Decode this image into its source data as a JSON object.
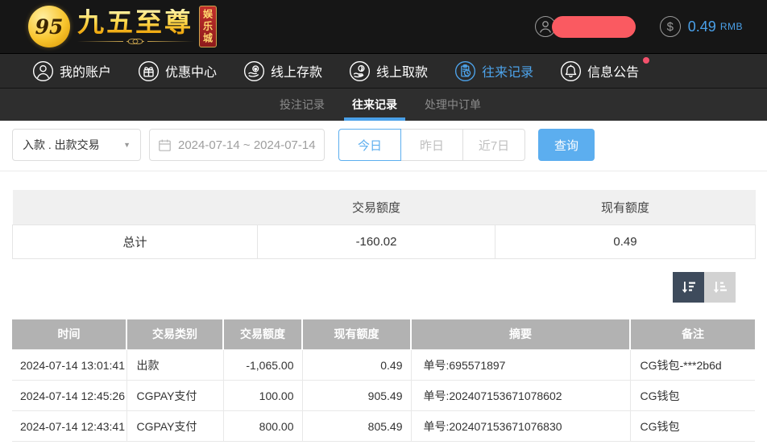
{
  "colors": {
    "accent_blue": "#4da3ea",
    "button_blue": "#5caeef",
    "tab_underline_blue": "#4aa0e8",
    "alert_dot_red": "#f4516c",
    "redacted_pill_red": "#fa5a61",
    "logo_gold": "#ffd94e",
    "logo_box_red": "#a6201f",
    "records_header_gray": "#b2b2b2",
    "top_header_bg": "#161616",
    "nav_bg": "#2a2a2a",
    "subtab_bg": "#2e2e2e"
  },
  "header": {
    "logo": {
      "monogram": "95",
      "title": "九五至尊",
      "subtitle": "娱乐城"
    },
    "user": {
      "avatar_icon": "user-avatar-icon",
      "dollar_icon_glyph": "$",
      "balance": "0.49",
      "currency": "RMB"
    }
  },
  "nav": {
    "items": [
      {
        "label": "我的账户",
        "icon": "account-icon",
        "active": false
      },
      {
        "label": "优惠中心",
        "icon": "promotions-gift-icon",
        "active": false
      },
      {
        "label": "线上存款",
        "icon": "deposit-icon",
        "active": false
      },
      {
        "label": "线上取款",
        "icon": "withdraw-icon",
        "active": false
      },
      {
        "label": "往来记录",
        "icon": "transfer-records-icon",
        "active": true
      },
      {
        "label": "信息公告",
        "icon": "announcements-bell-icon",
        "active": false,
        "has_unread_dot": true
      }
    ]
  },
  "subtabs": {
    "items": [
      {
        "label": "投注记录",
        "active": false
      },
      {
        "label": "往来记录",
        "active": true
      },
      {
        "label": "处理中订单",
        "active": false
      }
    ]
  },
  "filters": {
    "type_select": {
      "value": "入款 . 出款交易",
      "caret_glyph": "▼",
      "icon": "caret-down-icon"
    },
    "date_range": {
      "value": "2024-07-14 ~ 2024-07-14",
      "icon": "calendar-icon"
    },
    "quick_ranges": [
      {
        "label": "今日",
        "active": true
      },
      {
        "label": "昨日",
        "active": false
      },
      {
        "label": "近7日",
        "active": false
      }
    ],
    "search_button": "查询"
  },
  "summary_table": {
    "headers": {
      "corner": "",
      "amount": "交易额度",
      "balance": "现有额度"
    },
    "total_row": {
      "label": "总计",
      "amount": "-160.02",
      "balance": "0.49"
    }
  },
  "sort": {
    "desc_icon": "sort-descending-icon",
    "asc_icon": "sort-ascending-icon"
  },
  "records_table": {
    "headers": [
      "时间",
      "交易类别",
      "交易额度",
      "现有额度",
      "摘要",
      "备注"
    ],
    "rows": [
      {
        "time": "2024-07-14 13:01:41",
        "type": "出款",
        "amount": "-1,065.00",
        "balance": "0.49",
        "summary": "单号:695571897",
        "note": "CG钱包-***2b6d"
      },
      {
        "time": "2024-07-14 12:45:26",
        "type": "CGPAY支付",
        "amount": "100.00",
        "balance": "905.49",
        "summary": "单号:202407153671078602",
        "note": "CG钱包"
      },
      {
        "time": "2024-07-14 12:43:41",
        "type": "CGPAY支付",
        "amount": "800.00",
        "balance": "805.49",
        "summary": "单号:202407153671076830",
        "note": "CG钱包"
      }
    ]
  }
}
